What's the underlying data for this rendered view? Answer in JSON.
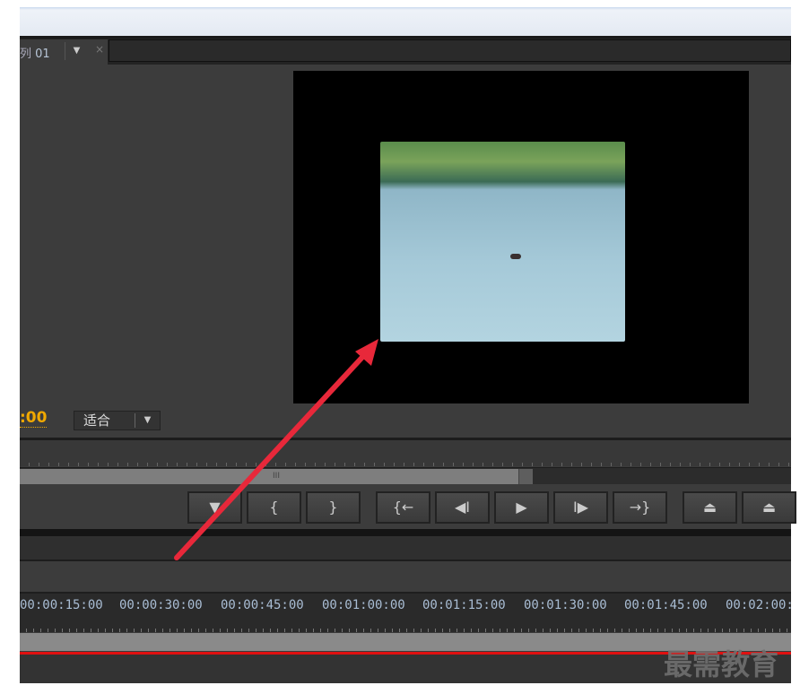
{
  "tab": {
    "label_partial": "列",
    "label_num": "01",
    "close": "×"
  },
  "monitor": {
    "timecode_partial": ":00",
    "zoom_select": "适合"
  },
  "transport": [
    "marker",
    "mark-in",
    "mark-out",
    "go-to-in",
    "step-back",
    "play",
    "step-forward",
    "go-to-out",
    "lift",
    "extract"
  ],
  "transport_glyphs": [
    "▼",
    "{",
    "}",
    "{←",
    "◀I",
    "▶",
    "I▶",
    "→}",
    "⏏",
    "⏏"
  ],
  "scrollbar_grip": "III",
  "timeline": {
    "ruler_labels": [
      "00:00:15:00",
      "00:00:30:00",
      "00:00:45:00",
      "00:01:00:00",
      "00:01:15:00",
      "00:01:30:00",
      "00:01:45:00",
      "00:02:00:"
    ]
  },
  "watermark": "最需教育",
  "annotation_color": "#e8283a"
}
